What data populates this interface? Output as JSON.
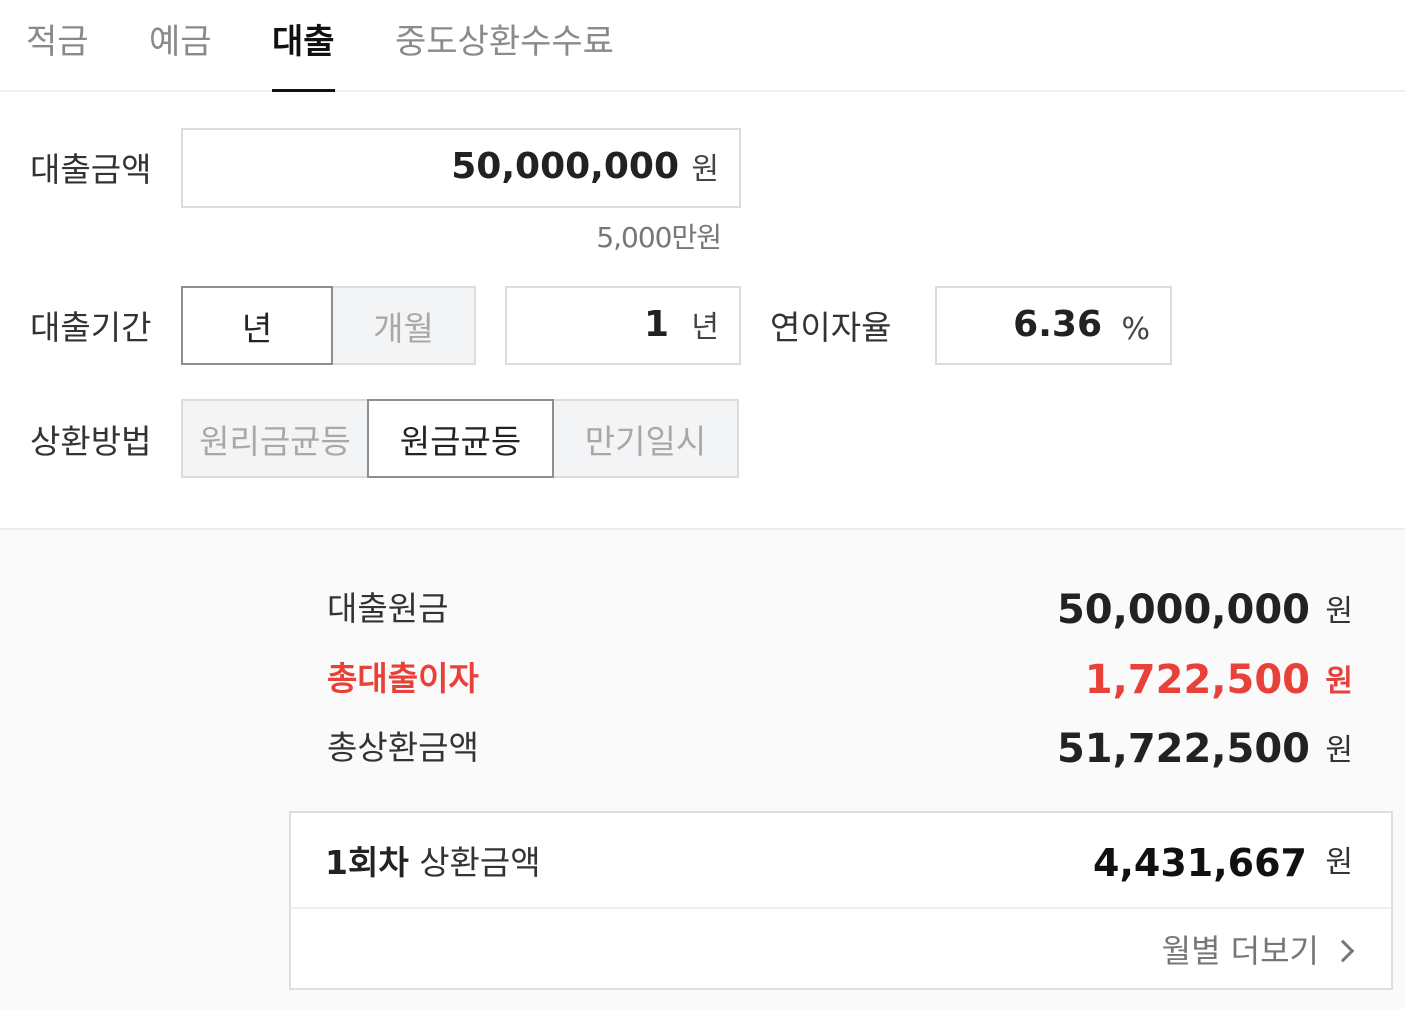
{
  "tabs": [
    {
      "label": "적금",
      "active": false
    },
    {
      "label": "예금",
      "active": false
    },
    {
      "label": "대출",
      "active": true
    },
    {
      "label": "중도상환수수료",
      "active": false
    }
  ],
  "loan_amount": {
    "label": "대출금액",
    "value": "50,000,000",
    "unit": "원",
    "hint": "5,000만원"
  },
  "loan_period": {
    "label": "대출기간",
    "options": [
      "년",
      "개월"
    ],
    "selected": "년",
    "value": "1",
    "unit": "년"
  },
  "interest": {
    "label": "연이자율",
    "value": "6.36",
    "unit": "%"
  },
  "repayment": {
    "label": "상환방법",
    "options": [
      "원리금균등",
      "원금균등",
      "만기일시"
    ],
    "selected": "원금균등"
  },
  "results": {
    "principal_label": "대출원금",
    "principal_value": "50,000,000",
    "total_interest_label": "총대출이자",
    "total_interest_value": "1,722,500",
    "total_repay_label": "총상환금액",
    "total_repay_value": "51,722,500",
    "unit": "원",
    "highlight_color": "#e8413a"
  },
  "first_payment": {
    "label_prefix": "1회차",
    "label": "상환금액",
    "value": "4,431,667",
    "unit": "원",
    "more_label": "월별 더보기"
  }
}
